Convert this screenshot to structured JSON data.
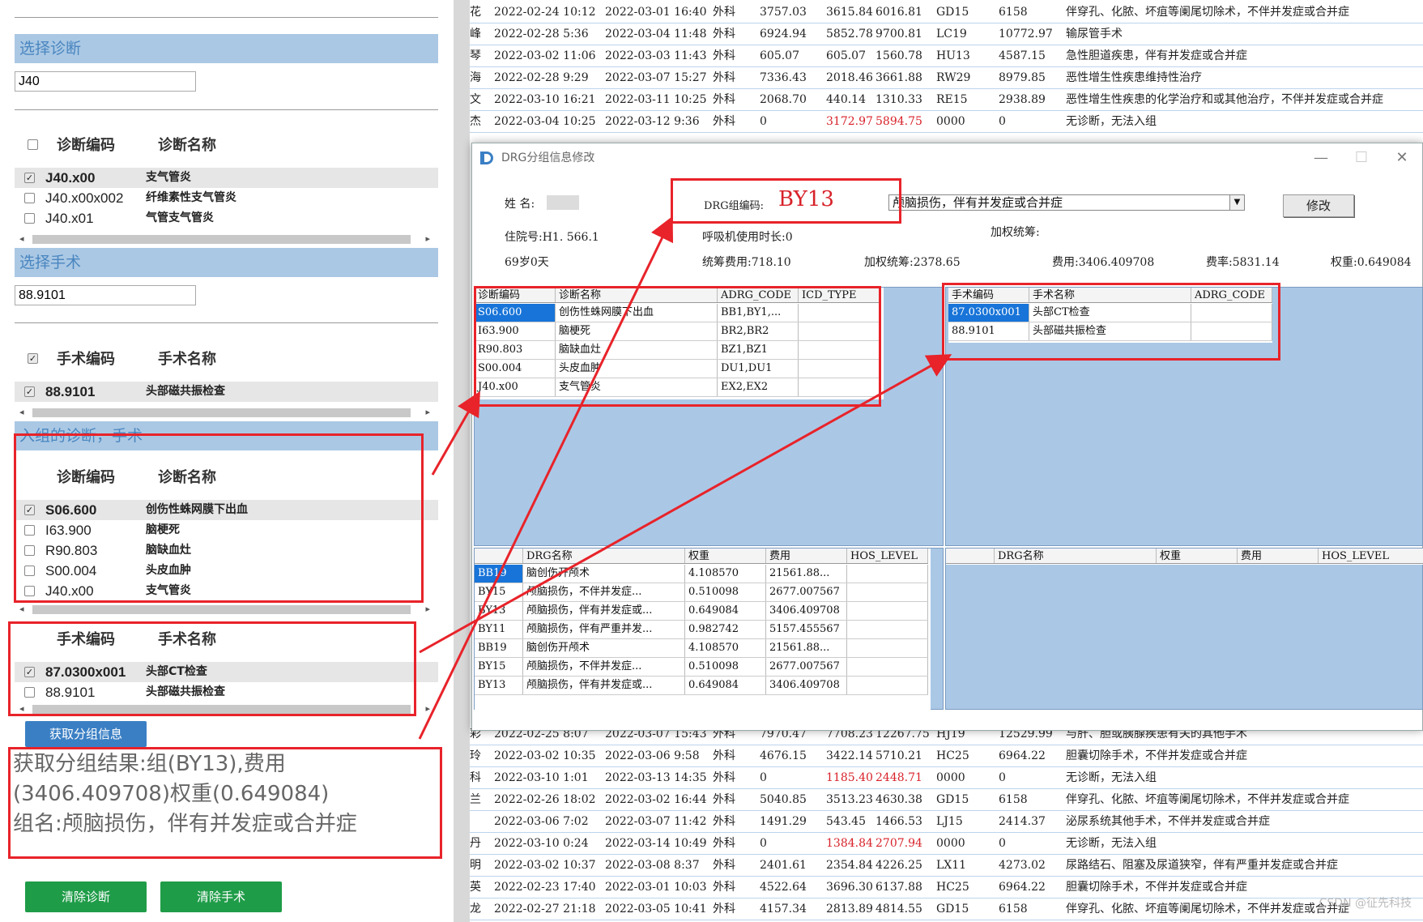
{
  "left": {
    "diag_section_title": "选择诊断",
    "diag_input": "J40",
    "diag_headers": {
      "code": "诊断编码",
      "name": "诊断名称"
    },
    "diag_rows": [
      {
        "code": "J40.x00",
        "name": "支气管炎",
        "checked": true
      },
      {
        "code": "J40.x00x002",
        "name": "纤维素性支气管炎",
        "checked": false
      },
      {
        "code": "J40.x01",
        "name": "气管支气管炎",
        "checked": false
      }
    ],
    "op_section_title": "选择手术",
    "op_input": "88.9101",
    "op_headers": {
      "code": "手术编码",
      "name": "手术名称"
    },
    "op_rows": [
      {
        "code": "88.9101",
        "name": "头部磁共振检查",
        "checked": true
      }
    ],
    "group_section_title": "入组的诊断，手术",
    "group_diag_headers": {
      "code": "诊断编码",
      "name": "诊断名称"
    },
    "group_diag_rows": [
      {
        "code": "S06.600",
        "name": "创伤性蛛网膜下出血",
        "checked": true
      },
      {
        "code": "I63.900",
        "name": "脑梗死",
        "checked": false
      },
      {
        "code": "R90.803",
        "name": "脑缺血灶",
        "checked": false
      },
      {
        "code": "S00.004",
        "name": "头皮血肿",
        "checked": false
      },
      {
        "code": "J40.x00",
        "name": "支气管炎",
        "checked": false
      }
    ],
    "group_op_headers": {
      "code": "手术编码",
      "name": "手术名称"
    },
    "group_op_rows": [
      {
        "code": "87.0300x001",
        "name": "头部CT检查",
        "checked": true
      },
      {
        "code": "88.9101",
        "name": "头部磁共振检查",
        "checked": false
      }
    ],
    "get_group_button": "获取分组信息",
    "result_line1": "获取分组结果:组(BY13),费用(3406.409708)权重(0.649084)",
    "result_line2": "组名:颅脑损伤，伴有并发症或合并症",
    "clear_diag_button": "清除诊断",
    "clear_op_button": "清除手术"
  },
  "background_rows_top": [
    {
      "name": "花",
      "in": "2022-02-24 10:12",
      "out": "2022-03-01 16:40",
      "dept": "外科",
      "a": "3757.03",
      "b": "3615.84",
      "c": "6016.81",
      "drg": "GD15",
      "d": "6158",
      "group": "伴穿孔、化脓、坏疽等阑尾切除术，不伴并发症或合并症",
      "red": false
    },
    {
      "name": "峰",
      "in": "2022-02-28 5:36",
      "out": "2022-03-04 11:48",
      "dept": "外科",
      "a": "6924.94",
      "b": "5852.78",
      "c": "9700.81",
      "drg": "LC19",
      "d": "10772.97",
      "group": "输尿管手术",
      "red": false
    },
    {
      "name": "琴",
      "in": "2022-03-02 11:06",
      "out": "2022-03-03 11:43",
      "dept": "外科",
      "a": "605.07",
      "b": "605.07",
      "c": "1560.78",
      "drg": "HU13",
      "d": "4587.15",
      "group": "急性胆道疾患，伴有并发症或合并症",
      "red": false
    },
    {
      "name": "海",
      "in": "2022-02-28 9:29",
      "out": "2022-03-07 15:27",
      "dept": "外科",
      "a": "7336.43",
      "b": "2018.46",
      "c": "3661.88",
      "drg": "RW29",
      "d": "8979.85",
      "group": "恶性增生性疾患维持性治疗",
      "red": false
    },
    {
      "name": "文",
      "in": "2022-03-10 16:21",
      "out": "2022-03-11 10:25",
      "dept": "外科",
      "a": "2068.70",
      "b": "440.14",
      "c": "1310.33",
      "drg": "RE15",
      "d": "2938.89",
      "group": "恶性增生性疾患的化学治疗和或其他治疗，不伴并发症或合并症",
      "red": false
    },
    {
      "name": "杰",
      "in": "2022-03-04 10:25",
      "out": "2022-03-12 9:36",
      "dept": "外科",
      "a": "0",
      "b": "3172.97",
      "c": "5894.75",
      "drg": "0000",
      "d": "0",
      "group": "无诊断，无法入组",
      "red": true
    }
  ],
  "background_rows_bottom": [
    {
      "name": "彩",
      "in": "2022-02-25 8:07",
      "out": "2022-03-07 15:43",
      "dept": "外科",
      "a": "7970.47",
      "b": "7708.23",
      "c": "12267.75",
      "drg": "HJ19",
      "d": "12529.99",
      "group": "与肝、胆或胰腺疾患有关的其他手术",
      "red": false
    },
    {
      "name": "玲",
      "in": "2022-03-02 10:35",
      "out": "2022-03-06 9:58",
      "dept": "外科",
      "a": "4676.15",
      "b": "3422.14",
      "c": "5710.21",
      "drg": "HC25",
      "d": "6964.22",
      "group": "胆囊切除手术，不伴并发症或合并症",
      "red": false
    },
    {
      "name": "科",
      "in": "2022-03-10 1:01",
      "out": "2022-03-13 14:35",
      "dept": "外科",
      "a": "0",
      "b": "1185.40",
      "c": "2448.71",
      "drg": "0000",
      "d": "0",
      "group": "无诊断，无法入组",
      "red": true
    },
    {
      "name": "兰",
      "in": "2022-02-26 18:02",
      "out": "2022-03-02 16:44",
      "dept": "外科",
      "a": "5040.85",
      "b": "3513.23",
      "c": "4630.38",
      "drg": "GD15",
      "d": "6158",
      "group": "伴穿孔、化脓、坏疽等阑尾切除术，不伴并发症或合并症",
      "red": false
    },
    {
      "name": "",
      "in": "2022-03-06 7:02",
      "out": "2022-03-07 11:42",
      "dept": "外科",
      "a": "1491.29",
      "b": "543.45",
      "c": "1466.53",
      "drg": "LJ15",
      "d": "2414.37",
      "group": "泌尿系统其他手术，不伴并发症或合并症",
      "red": false
    },
    {
      "name": "丹",
      "in": "2022-03-10 0:24",
      "out": "2022-03-14 10:49",
      "dept": "外科",
      "a": "0",
      "b": "1384.84",
      "c": "2707.94",
      "drg": "0000",
      "d": "0",
      "group": "无诊断，无法入组",
      "red": true
    },
    {
      "name": "明",
      "in": "2022-03-02 10:37",
      "out": "2022-03-08 8:37",
      "dept": "外科",
      "a": "2401.61",
      "b": "2354.84",
      "c": "4226.25",
      "drg": "LX11",
      "d": "4273.02",
      "group": "尿路结石、阻塞及尿道狭窄，伴有严重并发症或合并症",
      "red": false
    },
    {
      "name": "英",
      "in": "2022-02-23 17:40",
      "out": "2022-03-01 10:03",
      "dept": "外科",
      "a": "4522.64",
      "b": "3696.30",
      "c": "6137.88",
      "drg": "HC25",
      "d": "6964.22",
      "group": "胆囊切除手术，不伴并发症或合并症",
      "red": false
    },
    {
      "name": "龙",
      "in": "2022-02-27 21:18",
      "out": "2022-03-05 10:41",
      "dept": "外科",
      "a": "4157.34",
      "b": "2813.89",
      "c": "4814.55",
      "drg": "GD15",
      "d": "6158",
      "group": "伴穿孔、化脓、坏疽等阑尾切除术，不伴并发症或合并症",
      "red": false
    }
  ],
  "dialog": {
    "title": "DRG分组信息修改",
    "name_label": "姓 名:",
    "drg_code_label": "DRG组编码:",
    "drg_code_value": "BY13",
    "drg_name_combo": "颅脑损伤，伴有并发症或合并症",
    "modify_button": "修改",
    "inpatient_no": "住院号:H1.   566.1",
    "vent_hours": "呼吸机使用时长:0",
    "weighted_overall_label": "加权统筹:",
    "age": "69岁0天",
    "overall_cost": "统筹费用:718.10",
    "weighted_overall": "加权统筹:2378.65",
    "cost": "费用:3406.409708",
    "rate": "费率:5831.14",
    "weight": "权重:0.649084",
    "diag_grid_headers": [
      "诊断编码",
      "诊断名称",
      "ADRG_CODE",
      "ICD_TYPE"
    ],
    "diag_grid_rows": [
      [
        "S06.600",
        "创伤性蛛网膜下出血",
        "BB1,BY1,...",
        ""
      ],
      [
        "I63.900",
        "脑梗死",
        "BR2,BR2",
        ""
      ],
      [
        "R90.803",
        "脑缺血灶",
        "BZ1,BZ1",
        ""
      ],
      [
        "S00.004",
        "头皮血肿",
        "DU1,DU1",
        ""
      ],
      [
        "J40.x00",
        "支气管炎",
        "EX2,EX2",
        ""
      ]
    ],
    "op_grid_headers": [
      "手术编码",
      "手术名称",
      "ADRG_CODE"
    ],
    "op_grid_rows": [
      [
        "87.0300x001",
        "头部CT检查",
        ""
      ],
      [
        "88.9101",
        "头部磁共振检查",
        ""
      ]
    ],
    "drg_grid_headers": [
      "",
      "DRG名称",
      "权重",
      "费用",
      "HOS_LEVEL"
    ],
    "drg_grid_rows": [
      [
        "BB19",
        "脑创伤开颅术",
        "4.108570",
        "21561.88...",
        ""
      ],
      [
        "BY15",
        "颅脑损伤，不伴并发症...",
        "0.510098",
        "2677.007567",
        ""
      ],
      [
        "BY13",
        "颅脑损伤，伴有并发症或...",
        "0.649084",
        "3406.409708",
        ""
      ],
      [
        "BY11",
        "颅脑损伤，伴有严重并发...",
        "0.982742",
        "5157.455567",
        ""
      ],
      [
        "BB19",
        "脑创伤开颅术",
        "4.108570",
        "21561.88...",
        ""
      ],
      [
        "BY15",
        "颅脑损伤，不伴并发症...",
        "0.510098",
        "2677.007567",
        ""
      ],
      [
        "BY13",
        "颅脑损伤，伴有并发症或...",
        "0.649084",
        "3406.409708",
        ""
      ]
    ],
    "drg_grid2_headers": [
      "",
      "DRG名称",
      "权重",
      "费用",
      "HOS_LEVEL"
    ]
  },
  "watermark": "CSDN @征先科技",
  "colors": {
    "accent_red": "#e8232a",
    "highlight_blue": "#1874d8",
    "pane_blue": "#aac8e6",
    "button_green": "#1f9c48",
    "button_blue": "#3a7fc4"
  }
}
